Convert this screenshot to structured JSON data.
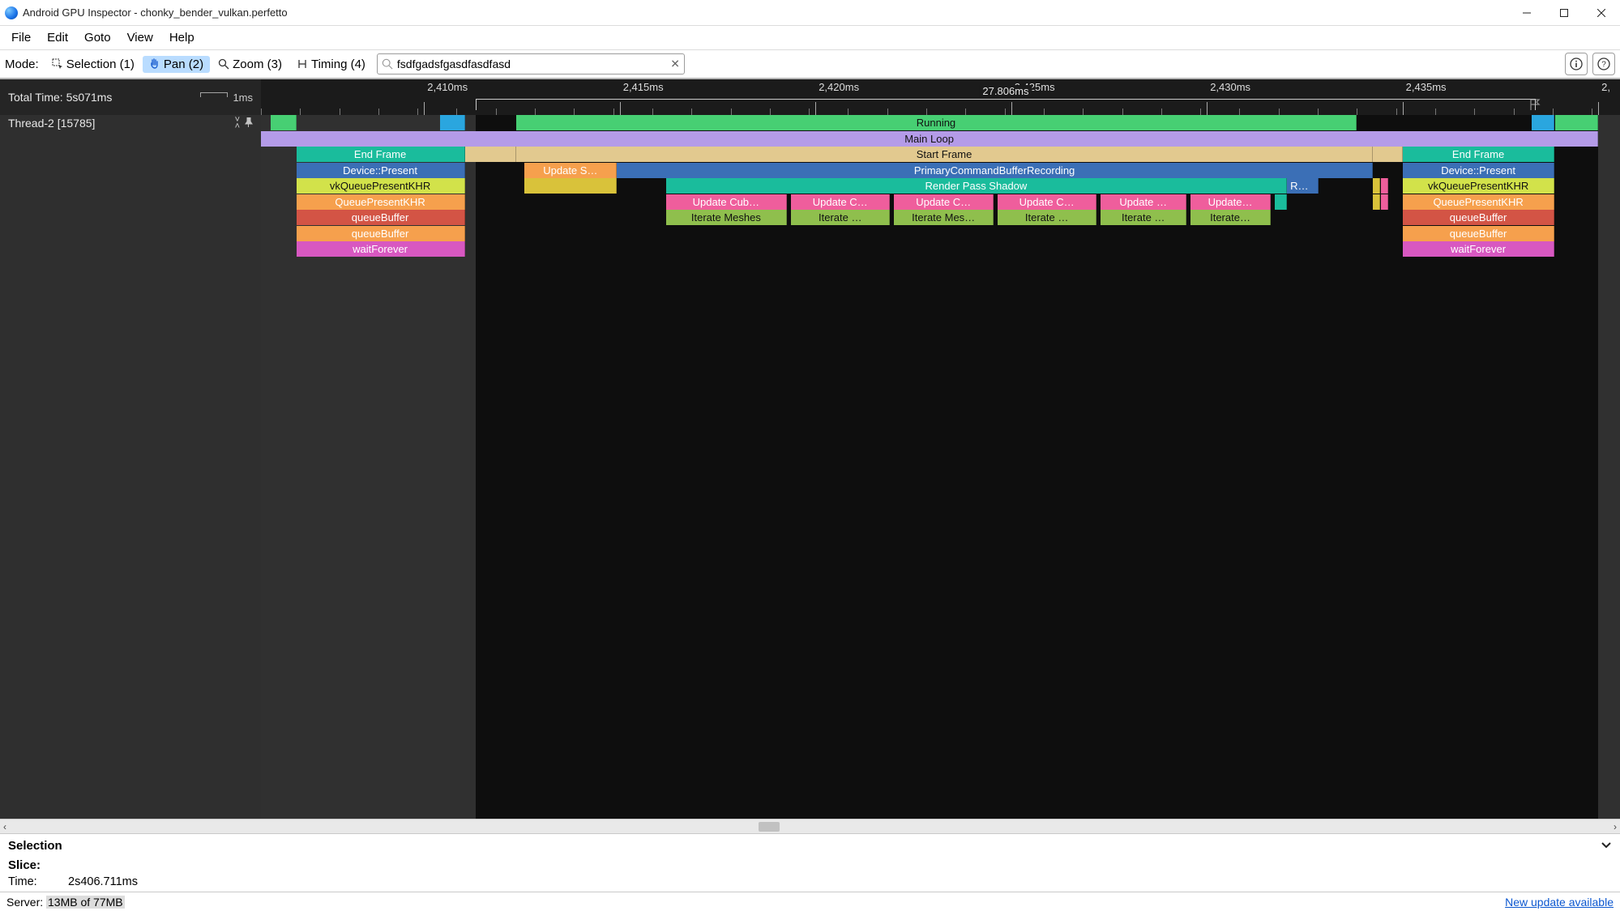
{
  "window": {
    "title": "Android GPU Inspector - chonky_bender_vulkan.perfetto"
  },
  "menubar": [
    "File",
    "Edit",
    "Goto",
    "View",
    "Help"
  ],
  "toolbar": {
    "mode_label": "Mode:",
    "modes": [
      {
        "label": "Selection (1)",
        "icon": "selection-icon",
        "active": false
      },
      {
        "label": "Pan (2)",
        "icon": "pan-icon",
        "active": true
      },
      {
        "label": "Zoom (3)",
        "icon": "zoom-icon",
        "active": false
      },
      {
        "label": "Timing (4)",
        "icon": "timing-icon",
        "active": false
      }
    ],
    "search": {
      "value": "fsdfgadsfgasdfasdfasd",
      "placeholder": ""
    }
  },
  "ruler": {
    "total_label": "Total Time: 5s071ms",
    "scale_label": "1ms",
    "ticks": [
      {
        "label": "2,410ms",
        "pct": 12.0
      },
      {
        "label": "2,415ms",
        "pct": 26.4
      },
      {
        "label": "2,420ms",
        "pct": 40.8
      },
      {
        "label": "2,425ms",
        "pct": 55.2
      },
      {
        "label": "2,430ms",
        "pct": 69.6
      },
      {
        "label": "2,435ms",
        "pct": 84.0
      },
      {
        "label": "2,",
        "pct": 98.4
      }
    ],
    "span": {
      "label": "27.806ms",
      "start_pct": 15.8,
      "end_pct": 93.8
    },
    "minor_every_pct": 2.88
  },
  "thread": {
    "label": "Thread-2 [15785]"
  },
  "highlight_band": {
    "start_pct": 0.0,
    "end_pct": 15.8
  },
  "rows": [
    [
      {
        "label": "",
        "color": "#47cf73",
        "start": 0.7,
        "end": 2.6,
        "dk": true
      },
      {
        "label": "",
        "color": "#2aa6df",
        "start": 13.2,
        "end": 15.0
      },
      {
        "label": "Running",
        "color": "#47cf73",
        "start": 18.8,
        "end": 80.6,
        "dk": true
      },
      {
        "label": "",
        "color": "#2aa6df",
        "start": 93.5,
        "end": 95.2
      },
      {
        "label": "",
        "color": "#47cf73",
        "start": 95.2,
        "end": 98.4,
        "dk": true
      }
    ],
    [
      {
        "label": "Main Loop",
        "color": "#b49be8",
        "start": 0.0,
        "end": 98.4,
        "dk": true
      }
    ],
    [
      {
        "label": "End Frame",
        "color": "#1abc9c",
        "start": 2.6,
        "end": 15.0
      },
      {
        "label": "",
        "color": "#e2c98f",
        "start": 15.0,
        "end": 18.8
      },
      {
        "label": "Start Frame",
        "color": "#e2c98f",
        "start": 18.8,
        "end": 81.8,
        "dk": true
      },
      {
        "label": "",
        "color": "#e2c98f",
        "start": 81.8,
        "end": 84.0
      },
      {
        "label": "End Frame",
        "color": "#1abc9c",
        "start": 84.0,
        "end": 95.2
      }
    ],
    [
      {
        "label": "Device::Present",
        "color": "#3b6fb6",
        "start": 2.6,
        "end": 15.0
      },
      {
        "label": "Update S…",
        "color": "#f6a04d",
        "start": 19.4,
        "end": 26.2
      },
      {
        "label": "PrimaryCommandBufferRecording",
        "color": "#3b6fb6",
        "start": 26.2,
        "end": 81.8
      },
      {
        "label": "Device::Present",
        "color": "#3b6fb6",
        "start": 84.0,
        "end": 95.2
      }
    ],
    [
      {
        "label": "vkQueuePresentKHR",
        "color": "#d2e24a",
        "start": 2.6,
        "end": 15.0,
        "dk": true
      },
      {
        "label": "",
        "color": "#d9c23a",
        "start": 19.4,
        "end": 26.2
      },
      {
        "label": "Render Pass Shadow",
        "color": "#1abc9c",
        "start": 29.8,
        "end": 75.5
      },
      {
        "label": "Re…",
        "color": "#3b6fb6",
        "start": 75.5,
        "end": 77.8
      },
      {
        "label": "vkQueuePresentKHR",
        "color": "#d2e24a",
        "start": 84.0,
        "end": 95.2,
        "dk": true
      }
    ],
    [
      {
        "label": "QueuePresentKHR",
        "color": "#f6a04d",
        "start": 2.6,
        "end": 15.0
      },
      {
        "label": "Update Cub…",
        "color": "#ef5e9c",
        "start": 29.8,
        "end": 38.7
      },
      {
        "label": "Update C…",
        "color": "#ef5e9c",
        "start": 39.0,
        "end": 46.3
      },
      {
        "label": "Update C…",
        "color": "#ef5e9c",
        "start": 46.6,
        "end": 53.9
      },
      {
        "label": "Update C…",
        "color": "#ef5e9c",
        "start": 54.2,
        "end": 61.5
      },
      {
        "label": "Update …",
        "color": "#ef5e9c",
        "start": 61.8,
        "end": 68.1
      },
      {
        "label": "Update…",
        "color": "#ef5e9c",
        "start": 68.4,
        "end": 74.3
      },
      {
        "label": "",
        "color": "#1abc9c",
        "start": 74.6,
        "end": 75.5
      },
      {
        "label": "QueuePresentKHR",
        "color": "#f6a04d",
        "start": 84.0,
        "end": 95.2
      }
    ],
    [
      {
        "label": "queueBuffer",
        "color": "#d35445",
        "start": 2.6,
        "end": 15.0
      },
      {
        "label": "Iterate Meshes",
        "color": "#8fbf4d",
        "start": 29.8,
        "end": 38.7,
        "dk": true
      },
      {
        "label": "Iterate …",
        "color": "#8fbf4d",
        "start": 39.0,
        "end": 46.3,
        "dk": true
      },
      {
        "label": "Iterate Mes…",
        "color": "#8fbf4d",
        "start": 46.6,
        "end": 53.9,
        "dk": true
      },
      {
        "label": "Iterate …",
        "color": "#8fbf4d",
        "start": 54.2,
        "end": 61.5,
        "dk": true
      },
      {
        "label": "Iterate …",
        "color": "#8fbf4d",
        "start": 61.8,
        "end": 68.1,
        "dk": true
      },
      {
        "label": "Iterate…",
        "color": "#8fbf4d",
        "start": 68.4,
        "end": 74.3,
        "dk": true
      },
      {
        "label": "queueBuffer",
        "color": "#d35445",
        "start": 84.0,
        "end": 95.2
      }
    ],
    [
      {
        "label": "queueBuffer",
        "color": "#f6a04d",
        "start": 2.6,
        "end": 15.0
      },
      {
        "label": "queueBuffer",
        "color": "#f6a04d",
        "start": 84.0,
        "end": 95.2
      }
    ],
    [
      {
        "label": "waitForever",
        "color": "#d858c1",
        "start": 2.6,
        "end": 15.0
      },
      {
        "label": "waitForever",
        "color": "#d858c1",
        "start": 84.0,
        "end": 95.2
      }
    ]
  ],
  "right_edge_splinters": [
    {
      "row": 4,
      "color": "#d9c23a",
      "start": 81.8,
      "end": 82.2
    },
    {
      "row": 4,
      "color": "#ef5e9c",
      "start": 82.4,
      "end": 82.8
    },
    {
      "row": 5,
      "color": "#d9c23a",
      "start": 81.8,
      "end": 82.2
    },
    {
      "row": 5,
      "color": "#ef5e9c",
      "start": 82.4,
      "end": 82.8
    }
  ],
  "hscroll": {
    "thumb_left_pct": 46.8,
    "thumb_width_pct": 1.3
  },
  "selection": {
    "header": "Selection",
    "slice_label": "Slice:",
    "time_label": "Time:",
    "time_value": "2s406.711ms"
  },
  "status": {
    "server_prefix": "Server: ",
    "server_mem": "13MB of 77MB",
    "update_link": "New update available"
  }
}
